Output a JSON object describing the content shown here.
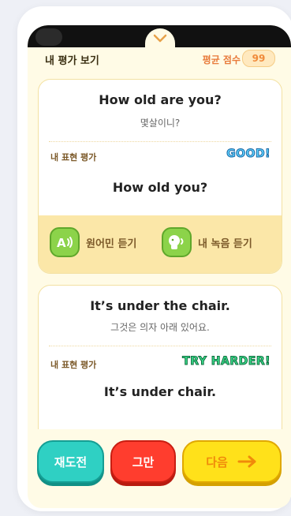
{
  "header": {
    "title": "내 평가 보기",
    "avg_label": "평균 점수",
    "avg_score": "99"
  },
  "cards": [
    {
      "question_en": "How old are you?",
      "question_ko": "몇살이니?",
      "eval_label": "내 표현 평가",
      "grade": "GOOD!",
      "answer": "How old you?",
      "listen_native": "원어민 듣기",
      "listen_mine": "내 녹음 듣기"
    },
    {
      "question_en": "It’s under the chair.",
      "question_ko": "그것은 의자 아래 있어요.",
      "eval_label": "내 표현 평가",
      "grade": "TRY HARDER!",
      "answer": "It’s under chair."
    }
  ],
  "actions": {
    "retry": "재도전",
    "stop": "그만",
    "next": "다음"
  },
  "icons": {
    "handle": "chevron-down-icon",
    "native": "native-speaker-icon",
    "mine": "my-recording-icon",
    "next": "arrow-right-icon"
  },
  "colors": {
    "retry": "#2fd0c3",
    "stop": "#ff3d2e",
    "next": "#ffe11a",
    "good": "#5fd3ff",
    "try_harder": "#3be08e",
    "accent": "#e87a3a"
  }
}
